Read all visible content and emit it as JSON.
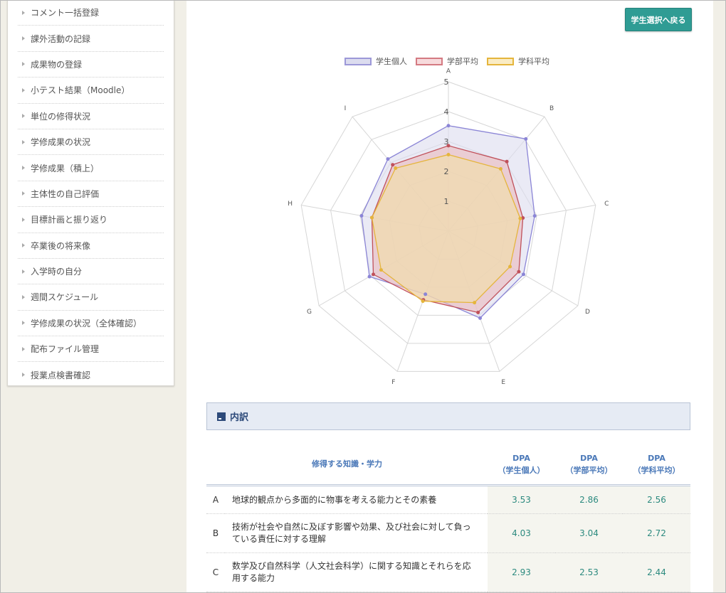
{
  "sidebar": {
    "items": [
      {
        "label": "コメント一括登録"
      },
      {
        "label": "課外活動の記録"
      },
      {
        "label": "成果物の登録"
      },
      {
        "label": "小テスト結果（Moodle）"
      },
      {
        "label": "単位の修得状況"
      },
      {
        "label": "学修成果の状況"
      },
      {
        "label": "学修成果（積上）"
      },
      {
        "label": "主体性の自己評価"
      },
      {
        "label": "目標計画と振り返り"
      },
      {
        "label": "卒業後の将来像"
      },
      {
        "label": "入学時の自分"
      },
      {
        "label": "週間スケジュール"
      },
      {
        "label": "学修成果の状況（全体確認）"
      },
      {
        "label": "配布ファイル管理"
      },
      {
        "label": "授業点検書確認"
      }
    ]
  },
  "header": {
    "back_button": "学生選択へ戻る"
  },
  "chart_data": {
    "type": "radar",
    "axes": [
      "A",
      "B",
      "C",
      "D",
      "E",
      "F",
      "G",
      "H",
      "I"
    ],
    "rlim": [
      0,
      5
    ],
    "ticks": [
      "1",
      "2",
      "3",
      "4",
      "5"
    ],
    "grid": true,
    "legend_position": "top",
    "series": [
      {
        "name": "学生個人",
        "values": [
          3.53,
          4.03,
          2.93,
          2.9,
          3.1,
          2.25,
          3.05,
          2.95,
          3.15
        ],
        "color": "#8b85d6",
        "fill": "#dcdcef"
      },
      {
        "name": "学部平均",
        "values": [
          2.86,
          3.04,
          2.53,
          2.72,
          2.9,
          2.45,
          2.9,
          2.6,
          2.9
        ],
        "color": "#c0505a",
        "fill": "#e9b9bd"
      },
      {
        "name": "学科平均",
        "values": [
          2.56,
          2.72,
          2.44,
          2.38,
          2.55,
          2.5,
          2.6,
          2.6,
          2.75
        ],
        "color": "#e5b53c",
        "fill": "#f2dfa6"
      }
    ]
  },
  "breakdown": {
    "title": "内訳",
    "columns": {
      "knowledge": "修得する知識・学力",
      "dpa_individual_1": "DPA",
      "dpa_individual_2": "（学生個人）",
      "dpa_faculty_1": "DPA",
      "dpa_faculty_2": "（学部平均）",
      "dpa_dept_1": "DPA",
      "dpa_dept_2": "（学科平均）"
    },
    "rows": [
      {
        "code": "A",
        "desc": "地球的観点から多面的に物事を考える能力とその素養",
        "individual": "3.53",
        "faculty": "2.86",
        "dept": "2.56"
      },
      {
        "code": "B",
        "desc": "技術が社会や自然に及ぼす影響や効果、及び社会に対して負っている責任に対する理解",
        "individual": "4.03",
        "faculty": "3.04",
        "dept": "2.72"
      },
      {
        "code": "C",
        "desc": "数学及び自然科学（人文社会科学）に関する知識とそれらを応用する能力",
        "individual": "2.93",
        "faculty": "2.53",
        "dept": "2.44"
      }
    ]
  }
}
